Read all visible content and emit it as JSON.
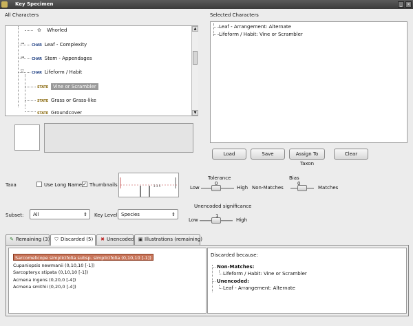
{
  "window": {
    "title": "Key Specimen"
  },
  "characters": {
    "all_label": "All Characters",
    "selected_label": "Selected Characters",
    "tree": [
      {
        "tag": "",
        "label": "Whorled"
      },
      {
        "tag": "CHAR",
        "label": "Leaf - Complexity"
      },
      {
        "tag": "CHAR",
        "label": "Stem - Appendages"
      },
      {
        "tag": "CHAR",
        "label": "Lifeform / Habit"
      },
      {
        "tag": "STATE",
        "label": "Vine or Scrambler"
      },
      {
        "tag": "STATE",
        "label": "Grass or Grass-like"
      },
      {
        "tag": "STATE",
        "label": "Groundcover"
      }
    ],
    "selected": [
      "Leaf - Arrangement: Alternate",
      "Lifeform / Habit: Vine or Scrambler"
    ]
  },
  "buttons": {
    "load": "Load",
    "save": "Save",
    "assign": "Assign To Taxon",
    "clear": "Clear"
  },
  "taxa": {
    "label": "Taxa",
    "use_long_names": "Use Long Names",
    "thumbnails": "Thumbnails",
    "subset_label": "Subset:",
    "subset_value": "All",
    "key_level_label": "Key Level:",
    "key_level_value": "Species"
  },
  "sliders": {
    "tolerance_label": "Tolerance",
    "tolerance_value": "0",
    "tolerance_low": "Low",
    "tolerance_high": "High",
    "tolerance_level": 0.45,
    "bias_label": "Bias",
    "bias_value": "0",
    "bias_left": "Non-Matches",
    "bias_right": "Matches",
    "bias_level": 0.5,
    "unencoded_label": "Unencoded significance",
    "unencoded_value": "1",
    "unencoded_low": "Low",
    "unencoded_high": "High",
    "unencoded_level": 0.5
  },
  "tabs": [
    {
      "label": "Remaining (3)",
      "icon": "leaf-icon"
    },
    {
      "label": "Discarded (5)",
      "icon": "shield-icon"
    },
    {
      "label": "Unencoded",
      "icon": "x-mark-icon"
    },
    {
      "label": "Illustrations (remaining)",
      "icon": "picture-icon"
    }
  ],
  "discarded": {
    "items": [
      "Sarcomelicope simplicifolia subsp. simplicifolia (0,10,10 [-1])",
      "Cupaniopsis newmanii (0,10,10 [-1])",
      "Sarcopteryx stipata (0,10,10 [-1])",
      "Acmena ingens (0,20,0 [-4])",
      "Acmena smithii (0,20,0 [-4])"
    ],
    "because_label": "Discarded because:",
    "non_matches_label": "Non-Matches:",
    "non_match_item": "Lifeform / Habit: Vine or Scrambler",
    "unencoded_label": "Unencoded:",
    "unencoded_item": "Leaf - Arrangement: Alternate"
  },
  "colors": {
    "selection": "#c8755a",
    "titlebar": "#4a4a4a"
  }
}
